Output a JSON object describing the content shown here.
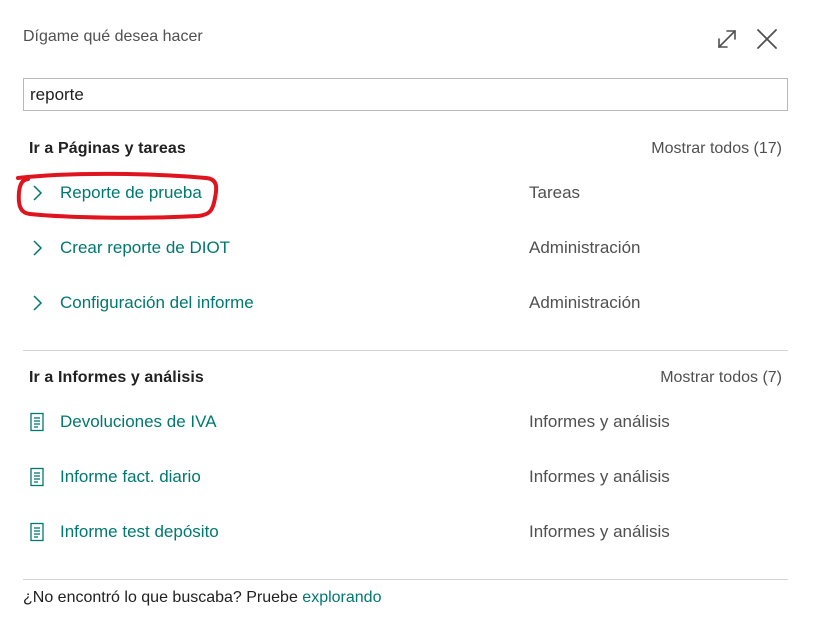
{
  "header": {
    "title": "Dígame qué desea hacer",
    "expand_icon": "expand-icon",
    "close_icon": "close-icon"
  },
  "search": {
    "value": "reporte"
  },
  "sections": [
    {
      "title": "Ir a Páginas y tareas",
      "show_all": "Mostrar todos (17)",
      "items": [
        {
          "label": "Reporte de prueba",
          "category": "Tareas",
          "icon": "chevron-right-icon"
        },
        {
          "label": "Crear reporte de DIOT",
          "category": "Administración",
          "icon": "chevron-right-icon"
        },
        {
          "label": "Configuración del informe",
          "category": "Administración",
          "icon": "chevron-right-icon"
        }
      ]
    },
    {
      "title": "Ir a Informes y análisis",
      "show_all": "Mostrar todos (7)",
      "items": [
        {
          "label": "Devoluciones de IVA",
          "category": "Informes y análisis",
          "icon": "report-icon"
        },
        {
          "label": "Informe fact. diario",
          "category": "Informes y análisis",
          "icon": "report-icon"
        },
        {
          "label": "Informe test depósito",
          "category": "Informes y análisis",
          "icon": "report-icon"
        }
      ]
    }
  ],
  "footer": {
    "text": "¿No encontró lo que buscaba? Pruebe ",
    "link": "explorando"
  },
  "colors": {
    "accent": "#00786f",
    "annotation": "#e0141e"
  }
}
